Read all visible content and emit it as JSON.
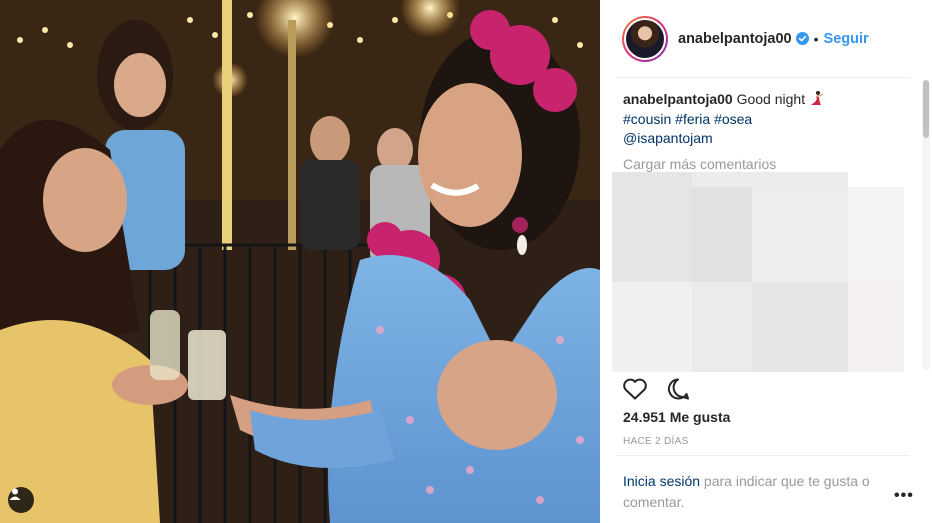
{
  "post": {
    "username": "anabelpantoja00",
    "follow_label": "Seguir",
    "separator": "•",
    "caption_user": "anabelpantoja00",
    "caption_text": "Good night",
    "hashtags": [
      "#cousin",
      "#feria",
      "#osea"
    ],
    "mention": "@isapantojam",
    "load_more": "Cargar más comentarios",
    "likes": "24.951 Me gusta",
    "time": "HACE 2 DÍAS",
    "login_link": "Inicia sesión",
    "login_text": " para indicar que te gusta o comentar.",
    "more_label": "•••"
  },
  "icons": {
    "verified": "verified-badge-icon",
    "caption_emoji": "flamenco-dancer-icon",
    "like": "heart-icon",
    "comment": "comment-icon",
    "tagged": "person-tag-icon"
  },
  "colors": {
    "link_blue": "#3897f0",
    "hashtag_blue": "#003569",
    "muted_gray": "#999999",
    "text_dark": "#262626"
  }
}
